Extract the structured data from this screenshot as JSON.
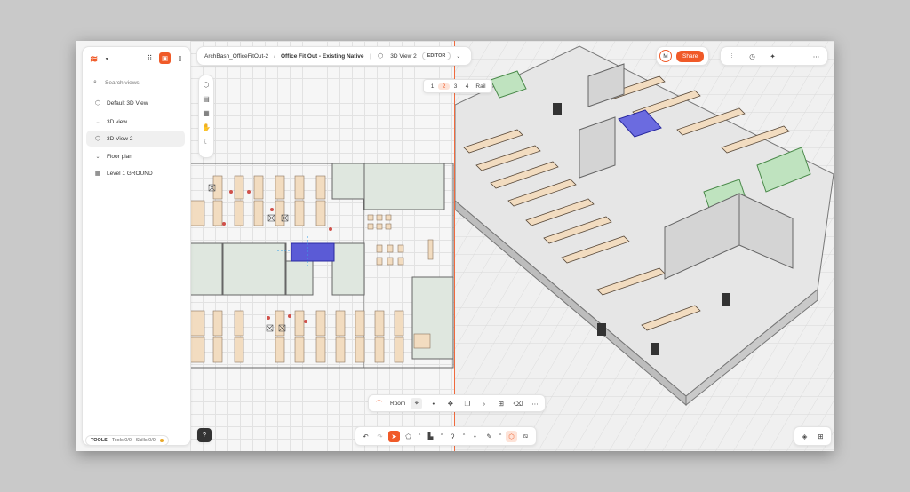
{
  "sidebar": {
    "search_placeholder": "Search views",
    "items": [
      {
        "label": "Default 3D View"
      },
      {
        "label": "3D view"
      },
      {
        "label": "3D View 2"
      },
      {
        "label": "Floor plan"
      },
      {
        "label": "Level 1 GROUND"
      }
    ],
    "footer": {
      "tools_label": "TOOLS",
      "status": "Tools 0/0 · Skills 0/0"
    },
    "help_label": "?"
  },
  "header": {
    "project": "ArchBash_OfficeFitOut-2",
    "separator": "/",
    "model": "Office Fit Out - Existing Native",
    "separator2": "|",
    "view": "3D View 2",
    "mode_badge": "EDITOR",
    "avatar_initial": "M",
    "share_label": "Share"
  },
  "view_tabs": [
    "1",
    "2",
    "3",
    "4",
    "Rail"
  ],
  "active_tab": "2",
  "context_toolbar": {
    "room_label": "Room"
  },
  "colors": {
    "accent": "#f05a28",
    "room_selected": "#5b5bd6",
    "green": "#5fbf5f",
    "desk": "#f2dcc0"
  },
  "icons": {
    "logo": "flame-logo-icon",
    "toolbar_top": [
      "grid-icon",
      "camera-icon",
      "panel-icon"
    ],
    "right_tools": [
      "sliders-icon",
      "clock-icon",
      "sparkle-icon",
      "more-icon"
    ]
  }
}
